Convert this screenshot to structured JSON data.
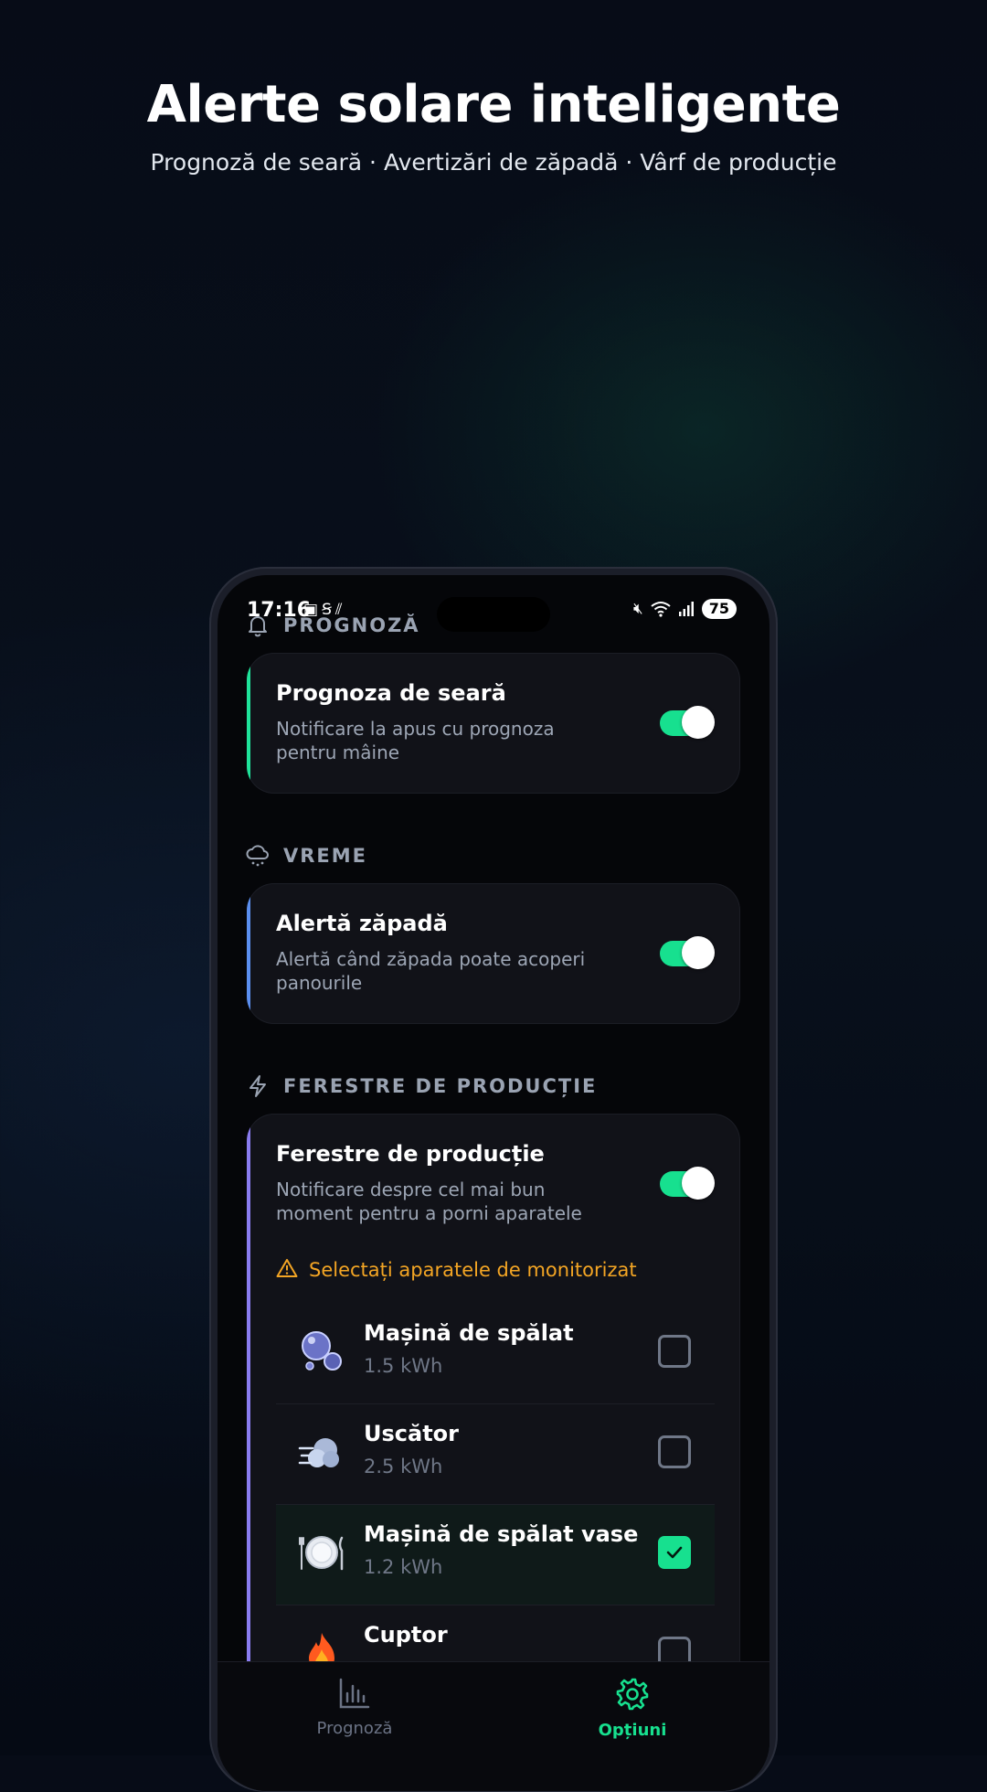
{
  "hero": {
    "title": "Alerte solare inteligente",
    "subtitle": "Prognoză de seară · Avertizări de zăpadă · Vârf de producție"
  },
  "status_bar": {
    "time": "17:16",
    "battery": "75",
    "icons": [
      "screenshot-icon",
      "s-app-icon",
      "data-icon",
      "mute-icon",
      "wifi-icon",
      "signal-icon",
      "battery-icon"
    ]
  },
  "sections": {
    "forecast": {
      "label": "PROGNOZĂ",
      "icon": "bell-icon",
      "card": {
        "title": "Prognoza de seară",
        "description": "Notificare la apus cu prognoza pentru mâine",
        "enabled": true,
        "accent": "#1fe39a"
      }
    },
    "weather": {
      "label": "VREME",
      "icon": "snow-cloud-icon",
      "card": {
        "title": "Alertă zăpadă",
        "description": "Alertă când zăpada poate acoperi panourile",
        "enabled": true,
        "accent": "#5b8ff0"
      }
    },
    "production": {
      "label": "FERESTRE DE PRODUCȚIE",
      "icon": "lightning-icon",
      "card": {
        "title": "Ferestre de producție",
        "description": "Notificare despre cel mai bun moment pentru a porni aparatele",
        "enabled": true,
        "accent": "#8a7cf0",
        "warning": "Selectați aparatele de monitorizat",
        "appliances": [
          {
            "name": "Mașină de spălat",
            "kwh": "1.5 kWh",
            "icon": "bubbles-icon",
            "selected": false
          },
          {
            "name": "Uscător",
            "kwh": "2.5 kWh",
            "icon": "wind-icon",
            "selected": false
          },
          {
            "name": "Mașină de spălat vase",
            "kwh": "1.2 kWh",
            "icon": "plate-icon",
            "selected": true
          },
          {
            "name": "Cuptor",
            "kwh": "",
            "icon": "fire-icon",
            "selected": false
          }
        ]
      }
    }
  },
  "bottom_nav": {
    "items": [
      {
        "label": "Prognoză",
        "icon": "bar-chart-icon",
        "active": false
      },
      {
        "label": "Opțiuni",
        "icon": "gear-icon",
        "active": true
      }
    ]
  },
  "colors": {
    "accent_green": "#17e08f",
    "warning": "#f3a524",
    "muted": "#9da6b5"
  }
}
